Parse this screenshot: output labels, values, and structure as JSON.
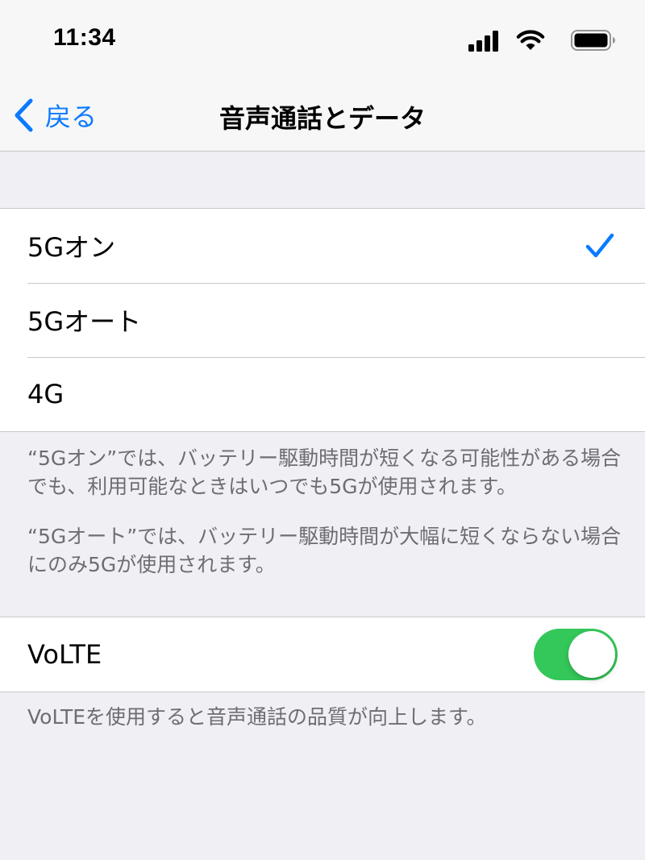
{
  "status_bar": {
    "time": "11:34",
    "icons": [
      "cellular-signal-icon",
      "wifi-icon",
      "battery-icon"
    ]
  },
  "nav": {
    "back_label": "戻る",
    "title": "音声通話とデータ",
    "accent_color": "#0a7aff"
  },
  "network_options": {
    "items": [
      {
        "label": "5Gオン",
        "selected": true
      },
      {
        "label": "5Gオート",
        "selected": false
      },
      {
        "label": "4G",
        "selected": false
      }
    ],
    "footer_1": "“5Gオン”では、バッテリー駆動時間が短くなる可能性がある場合でも、利用可能なときはいつでも5Gが使用されます。",
    "footer_2": "“5Gオート”では、バッテリー駆動時間が大幅に短くならない場合にのみ5Gが使用されます。"
  },
  "volte": {
    "label": "VoLTE",
    "enabled": true,
    "toggle_color": "#34c759",
    "footer": "VoLTEを使用すると音声通話の品質が向上します。"
  }
}
